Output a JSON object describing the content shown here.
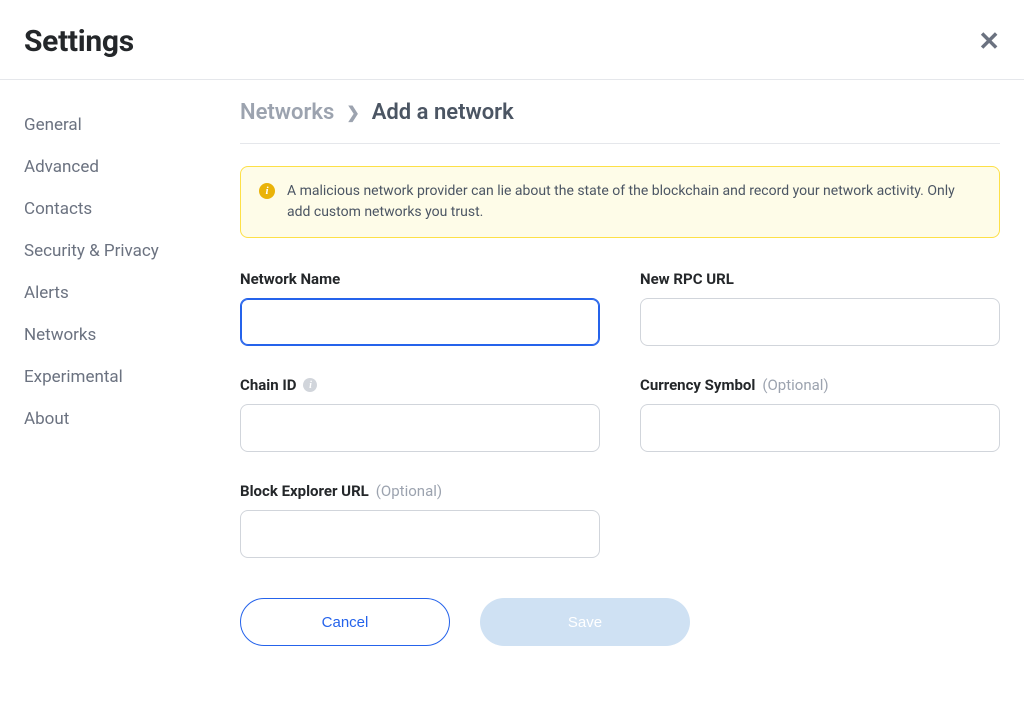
{
  "header": {
    "title": "Settings"
  },
  "sidebar": {
    "items": [
      {
        "label": "General"
      },
      {
        "label": "Advanced"
      },
      {
        "label": "Contacts"
      },
      {
        "label": "Security & Privacy"
      },
      {
        "label": "Alerts"
      },
      {
        "label": "Networks"
      },
      {
        "label": "Experimental"
      },
      {
        "label": "About"
      }
    ]
  },
  "breadcrumb": {
    "parent": "Networks",
    "current": "Add a network"
  },
  "warning": {
    "text": "A malicious network provider can lie about the state of the blockchain and record your network activity. Only add custom networks you trust."
  },
  "form": {
    "network_name": {
      "label": "Network Name",
      "value": ""
    },
    "rpc_url": {
      "label": "New RPC URL",
      "value": ""
    },
    "chain_id": {
      "label": "Chain ID",
      "value": ""
    },
    "currency_symbol": {
      "label": "Currency Symbol",
      "optional": "(Optional)",
      "value": ""
    },
    "block_explorer": {
      "label": "Block Explorer URL",
      "optional": "(Optional)",
      "value": ""
    }
  },
  "actions": {
    "cancel": "Cancel",
    "save": "Save"
  }
}
